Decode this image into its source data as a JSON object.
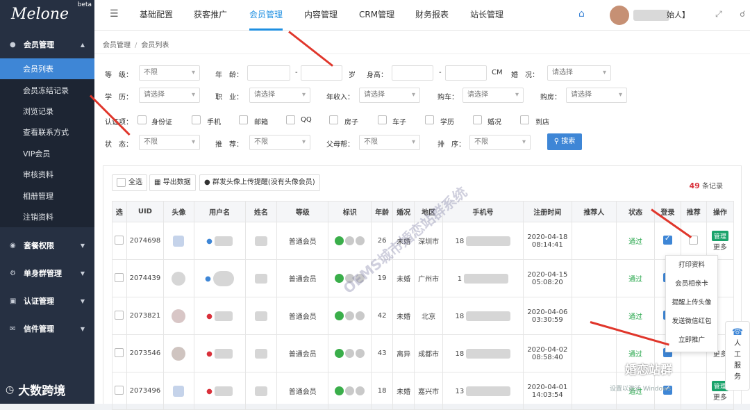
{
  "sidebar": {
    "logo_text": "Melone",
    "beta": "beta",
    "groups": [
      {
        "label": "会员管理",
        "items": [
          "会员列表",
          "会员冻结记录",
          "浏览记录",
          "查看联系方式",
          "VIP会员",
          "审核资料",
          "相册管理",
          "注销资料"
        ]
      },
      {
        "label": "套餐权限"
      },
      {
        "label": "单身群管理"
      },
      {
        "label": "认证管理"
      },
      {
        "label": "信件管理"
      }
    ]
  },
  "watermark_left": "大数跨境",
  "topbar": {
    "tabs": [
      "基础配置",
      "获客推广",
      "会员管理",
      "内容管理",
      "CRM管理",
      "财务报表",
      "站长管理"
    ],
    "active_tab": "会员管理",
    "user_suffix": "始人】"
  },
  "breadcrumb": [
    "会员管理",
    "会员列表"
  ],
  "filters": {
    "level_label": "等　级：",
    "level_value": "不限",
    "age_label": "年　龄：",
    "age_sep": "-",
    "age_unit": "岁",
    "height_label": "身高：",
    "height_sep": "-",
    "height_unit": "CM",
    "marriage_label": "婚　况：",
    "marriage_value": "请选择",
    "edu_label": "学　历：",
    "edu_value": "请选择",
    "job_label": "职　业：",
    "job_value": "请选择",
    "income_label": "年收入：",
    "income_value": "请选择",
    "car_label": "购车：",
    "car_value": "请选择",
    "house_label": "购房：",
    "house_value": "请选择",
    "cert_label": "认证项：",
    "cert_items": [
      "身份证",
      "手机",
      "邮箱",
      "QQ",
      "房子",
      "车子",
      "学历",
      "婚况",
      "到店"
    ],
    "status_label": "状　态：",
    "status_value": "不限",
    "recommend_label": "推　荐：",
    "recommend_value": "不限",
    "parent_label": "父母帮：",
    "parent_value": "不限",
    "sort_label": "排　序：",
    "sort_value": "不限",
    "search_button": "搜索"
  },
  "toolbar": {
    "select_all": "全选",
    "export": "导出数据",
    "remind": "群发头像上传提醒(没有头像会员)",
    "records_count": "49",
    "records_suffix": "条记录"
  },
  "table": {
    "headers": [
      "选",
      "UID",
      "头像",
      "用户名",
      "姓名",
      "等级",
      "标识",
      "年龄",
      "婚况",
      "地区",
      "手机号",
      "注册时间",
      "推荐人",
      "状态",
      "登录",
      "推荐",
      "操作"
    ],
    "rows": [
      {
        "uid": "2074698",
        "level": "普通会员",
        "age": "26",
        "marriage": "未婚",
        "region": "深圳市",
        "phone_prefix": "18",
        "date": "2020-04-18",
        "time": "08:14:41",
        "status": "通过"
      },
      {
        "uid": "2074439",
        "level": "普通会员",
        "age": "19",
        "marriage": "未婚",
        "region": "广州市",
        "phone_prefix": "1",
        "date": "2020-04-15",
        "time": "05:08:20",
        "status": "通过"
      },
      {
        "uid": "2073821",
        "level": "普通会员",
        "age": "42",
        "marriage": "未婚",
        "region": "北京",
        "phone_prefix": "18",
        "date": "2020-04-06",
        "time": "03:30:59",
        "status": "通过"
      },
      {
        "uid": "2073546",
        "level": "普通会员",
        "age": "43",
        "marriage": "离异",
        "region": "成都市",
        "phone_prefix": "18",
        "date": "2020-04-02",
        "time": "08:58:40",
        "status": "通过"
      },
      {
        "uid": "2073496",
        "level": "普通会员",
        "age": "18",
        "marriage": "未婚",
        "region": "嘉兴市",
        "phone_prefix": "13",
        "date": "2020-04-01",
        "time": "14:03:54",
        "status": "通过"
      }
    ],
    "manage_tag": "管理",
    "more_label": "更多"
  },
  "dropdown_items": [
    "打印资料",
    "会员相亲卡",
    "提醒上传头像",
    "发送微信红包",
    "立即推广"
  ],
  "helper_text": [
    "人",
    "工",
    "服",
    "务"
  ],
  "watermark_center": "OEMS城市婚恋站群系统",
  "watermark_bottom": "婚恋站群",
  "win_activate": "设置以激活 Windows"
}
